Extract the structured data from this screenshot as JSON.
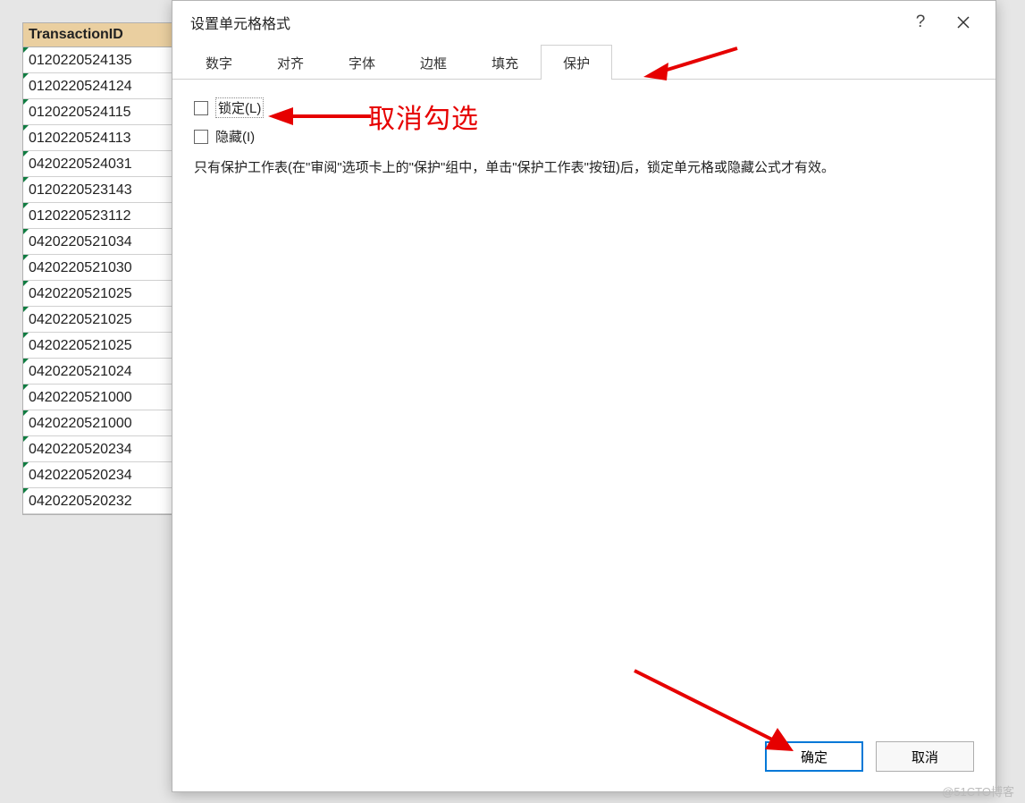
{
  "sheet": {
    "header": "TransactionID",
    "rows": [
      "0120220524135",
      "0120220524124",
      "0120220524115",
      "0120220524113",
      "0420220524031",
      "0120220523143",
      "0120220523112",
      "0420220521034",
      "0420220521030",
      "0420220521025",
      "0420220521025",
      "0420220521025",
      "0420220521024",
      "0420220521000",
      "0420220521000",
      "0420220520234",
      "0420220520234",
      "0420220520232"
    ]
  },
  "dialog": {
    "title": "设置单元格格式",
    "help_symbol": "?",
    "tabs": {
      "number": "数字",
      "align": "对齐",
      "font": "字体",
      "border": "边框",
      "fill": "填充",
      "protect": "保护"
    },
    "checkboxes": {
      "lock": "锁定(L)",
      "hide": "隐藏(I)"
    },
    "info": "只有保护工作表(在\"审阅\"选项卡上的\"保护\"组中，单击\"保护工作表\"按钮)后，锁定单元格或隐藏公式才有效。",
    "buttons": {
      "ok": "确定",
      "cancel": "取消"
    }
  },
  "annotations": {
    "uncheck_text": "取消勾选"
  },
  "watermark": "@51CTO博客"
}
